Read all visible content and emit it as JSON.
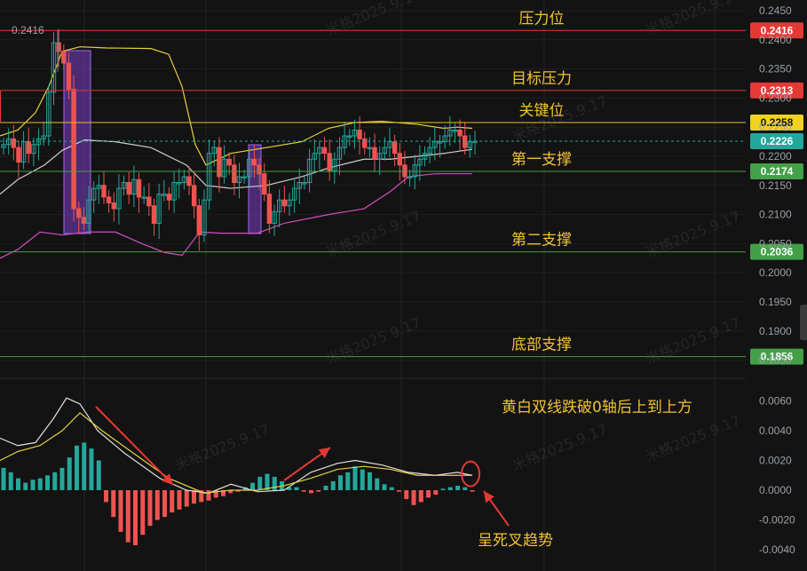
{
  "price_axis": {
    "ticks": [
      "0.2450",
      "0.2400",
      "0.2350",
      "0.2300",
      "0.2250",
      "0.2200",
      "0.2150",
      "0.2100",
      "0.2050",
      "0.2000",
      "0.1950",
      "0.1900",
      "0.1850"
    ],
    "tick_values": [
      0.245,
      0.24,
      0.235,
      0.23,
      0.225,
      0.22,
      0.215,
      0.21,
      0.205,
      0.2,
      0.195,
      0.19,
      0.185
    ]
  },
  "macd_axis": {
    "ticks": [
      "0.0060",
      "0.0040",
      "0.0020",
      "0.0000",
      "-0.0020",
      "-0.0040"
    ],
    "tick_values": [
      0.006,
      0.004,
      0.002,
      0,
      -0.002,
      -0.004
    ]
  },
  "levels": [
    {
      "value": 0.2416,
      "tag": "0.2416",
      "label": "压力位",
      "color": "#e53935",
      "tag_bg": "#e53935",
      "tag_fg": "#ffffff"
    },
    {
      "value": 0.2313,
      "tag": "0.2313",
      "label": "目标压力",
      "color": "#e53935",
      "tag_bg": "#e53935",
      "tag_fg": "#ffffff"
    },
    {
      "value": 0.2258,
      "tag": "0.2258",
      "label": "关键位",
      "color": "#e6c229",
      "tag_bg": "#f1d21f",
      "tag_fg": "#111111"
    },
    {
      "value": 0.2226,
      "tag": "0.2226",
      "label": "",
      "color": "#26a69a",
      "tag_bg": "#26a69a",
      "tag_fg": "#ffffff"
    },
    {
      "value": 0.2174,
      "tag": "0.2174",
      "label": "第一支撑",
      "color": "#43a047",
      "tag_bg": "#43a047",
      "tag_fg": "#ffffff"
    },
    {
      "value": 0.2036,
      "tag": "0.2036",
      "label": "第二支撑",
      "color": "#43a047",
      "tag_bg": "#43a047",
      "tag_fg": "#ffffff"
    },
    {
      "value": 0.1856,
      "tag": "0.1856",
      "label": "底部支撑",
      "color": "#43a047",
      "tag_bg": "#43a047",
      "tag_fg": "#ffffff"
    }
  ],
  "high_marker": "0.2416",
  "macd_annotation": "黄白双线跌破0轴后上到上方",
  "cross_annotation": "呈死叉趋势",
  "watermark": "米格2025.9.17",
  "colors": {
    "up": "#26a69a",
    "down": "#ef5350",
    "bb_upper": "#e6d23a",
    "bb_mid": "#cfcfcf",
    "bb_lower": "#d04fbf",
    "dif": "#e0e0e0",
    "dea": "#e6d23a",
    "highlight": "#7b3fc4",
    "arrow": "#e53935"
  },
  "chart_data": {
    "type": "candlestick",
    "price_series": {
      "close_approx": [
        0.222,
        0.223,
        0.2215,
        0.219,
        0.2225,
        0.2205,
        0.222,
        0.223,
        0.2235,
        0.231,
        0.2395,
        0.238,
        0.236,
        0.2315,
        0.211,
        0.2095,
        0.2085,
        0.2125,
        0.2145,
        0.215,
        0.213,
        0.212,
        0.211,
        0.2145,
        0.2155,
        0.2135,
        0.216,
        0.213,
        0.213,
        0.2115,
        0.2085,
        0.2135,
        0.2135,
        0.2125,
        0.2155,
        0.2155,
        0.2165,
        0.215,
        0.2115,
        0.2065,
        0.2125,
        0.2205,
        0.2215,
        0.2165,
        0.2195,
        0.2185,
        0.2155,
        0.2165,
        0.2165,
        0.2195,
        0.2185,
        0.217,
        0.2135,
        0.2085,
        0.2105,
        0.2125,
        0.2115,
        0.2125,
        0.2145,
        0.2155,
        0.2155,
        0.2195,
        0.2205,
        0.2215,
        0.2205,
        0.2175,
        0.2195,
        0.2215,
        0.2235,
        0.2235,
        0.2245,
        0.223,
        0.2215,
        0.2215,
        0.2195,
        0.2205,
        0.2215,
        0.2225,
        0.2205,
        0.2185,
        0.2165,
        0.2165,
        0.2185,
        0.2195,
        0.2205,
        0.2215,
        0.2225,
        0.2225,
        0.2235,
        0.2245,
        0.2245,
        0.2235,
        0.2215,
        0.2225,
        0.2226
      ]
    },
    "macd_histogram_approx": [
      0.0015,
      0.0012,
      0.0008,
      0.0005,
      0.0007,
      0.0008,
      0.001,
      0.0012,
      0.0015,
      0.0022,
      0.003,
      0.0032,
      0.0028,
      0.002,
      -0.0008,
      -0.0018,
      -0.0028,
      -0.0035,
      -0.0037,
      -0.003,
      -0.0024,
      -0.002,
      -0.0018,
      -0.0015,
      -0.0013,
      -0.0011,
      -0.0009,
      -0.0008,
      -0.0007,
      -0.0005,
      -0.0004,
      -0.0002,
      -0.0001,
      0.0002,
      0.0005,
      0.0009,
      0.0011,
      0.0009,
      0.0006,
      0.0002,
      0.0002,
      -0.0001,
      -0.0002,
      -0.0001,
      0.0003,
      0.0006,
      0.001,
      0.0012,
      0.0016,
      0.0014,
      0.0012,
      0.0008,
      0.0004,
      0.0002,
      -0.0001,
      -0.0006,
      -0.001,
      -0.0008,
      -0.0005,
      -0.0003,
      0.0001,
      0.0002,
      0.0003,
      0.0002,
      -0.0001
    ],
    "title": "",
    "xlabel": "",
    "ylabel": "",
    "ylim_price": [
      0.1825,
      0.2465
    ],
    "ylim_macd": [
      -0.0045,
      0.0065
    ],
    "grid": true
  }
}
